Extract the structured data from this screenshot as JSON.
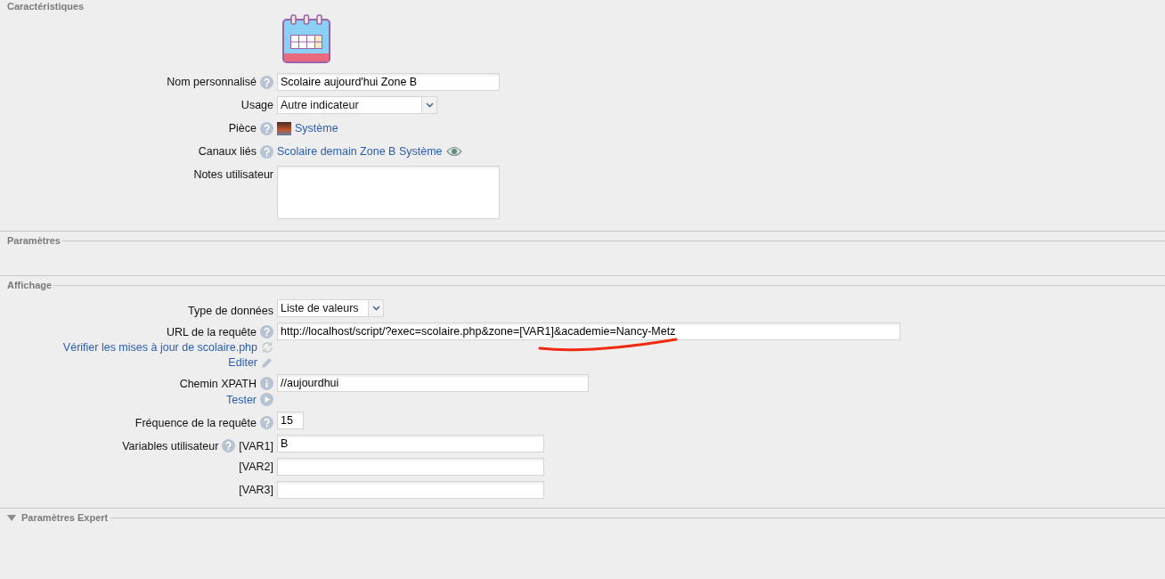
{
  "caracteristiques": {
    "title": "Caractéristiques",
    "rows": [
      {
        "kind": "text",
        "label": "Nom personnalisé",
        "help": true,
        "value": "Scolaire aujourd'hui Zone B"
      },
      {
        "kind": "select",
        "label": "Usage",
        "help": false,
        "value": "Autre indicateur"
      },
      {
        "kind": "room",
        "label": "Pièce",
        "help": true,
        "value": "Système"
      },
      {
        "kind": "linked",
        "label": "Canaux liés",
        "help": true,
        "value": "Scolaire demain Zone B Système"
      },
      {
        "kind": "textarea",
        "label": "Notes utilisateur",
        "help": false
      }
    ]
  },
  "parametres": {
    "title": "Paramètres"
  },
  "affichage": {
    "title": "Affichage",
    "rows": [
      {
        "kind": "select-short",
        "label": "Type de données",
        "help": false,
        "value": "Liste de valeurs"
      },
      {
        "kind": "url",
        "label": "URL de la requête",
        "help": true,
        "value": "http://localhost/script/?exec=scolaire.php&zone=[VAR1]&academie=Nancy-Metz",
        "links": [
          {
            "kind": "refresh",
            "label": "Vérifier les mises à jour de scolaire.php"
          },
          {
            "kind": "edit",
            "label": "Editer"
          }
        ]
      },
      {
        "kind": "xpath",
        "label": "Chemin XPATH",
        "help": true,
        "value": "//aujourdhui",
        "links": [
          {
            "kind": "play",
            "label": "Tester"
          }
        ]
      },
      {
        "kind": "number",
        "label": "Fréquence de la requête",
        "help": true,
        "value": "15"
      },
      {
        "kind": "vars",
        "label": "Variables utilisateur",
        "help": true,
        "vars": [
          {
            "name": "[VAR1]",
            "value": "B"
          },
          {
            "name": "[VAR2]"
          },
          {
            "name": "[VAR3]"
          }
        ]
      }
    ]
  },
  "expert": {
    "title": "Paramètres Expert"
  }
}
